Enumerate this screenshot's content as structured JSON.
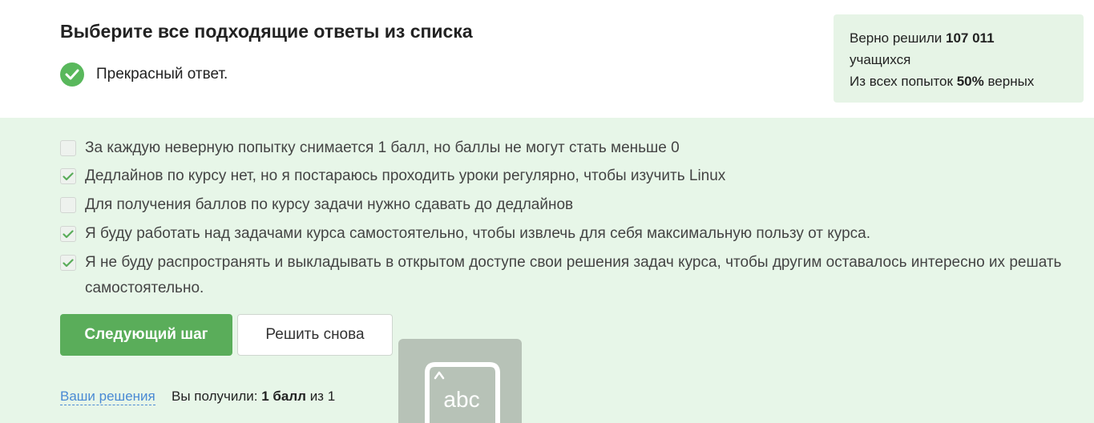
{
  "question": {
    "title": "Выберите все подходящие ответы из списка",
    "feedback": "Прекрасный ответ."
  },
  "stats": {
    "solved_prefix": "Верно решили",
    "solved_count": "107 011",
    "solved_suffix": "учащихся",
    "attempts_prefix": "Из всех попыток",
    "attempts_percent": "50%",
    "attempts_suffix": "верных"
  },
  "options": [
    {
      "text": "За каждую неверную попытку снимается 1 балл, но баллы не могут стать меньше 0",
      "checked": false
    },
    {
      "text": "Дедлайнов по курсу нет, но я постараюсь проходить уроки регулярно, чтобы изучить Linux",
      "checked": true
    },
    {
      "text": "Для получения баллов по курсу задачи нужно сдавать до дедлайнов",
      "checked": false
    },
    {
      "text": "Я буду работать над задачами курса самостоятельно, чтобы извлечь для себя максимальную пользу от курса.",
      "checked": true
    },
    {
      "text": "Я не буду распространять и выкладывать в открытом доступе свои решения задач курса, чтобы другим оставалось интересно их решать самостоятельно.",
      "checked": true
    }
  ],
  "actions": {
    "next_step": "Следующий шаг",
    "solve_again": "Решить снова"
  },
  "widget": {
    "label": "abc",
    "icon": "keyboard-abc-icon"
  },
  "footer": {
    "solutions_link": "Ваши решения",
    "score_prefix": "Вы получили:",
    "score_value": "1 балл",
    "score_suffix": "из 1"
  },
  "colors": {
    "accent": "#5aad5a",
    "success": "#59b85c",
    "answer_bg": "#e7f6e8",
    "stats_bg": "#e6f4e6",
    "link": "#4a8ad4"
  }
}
